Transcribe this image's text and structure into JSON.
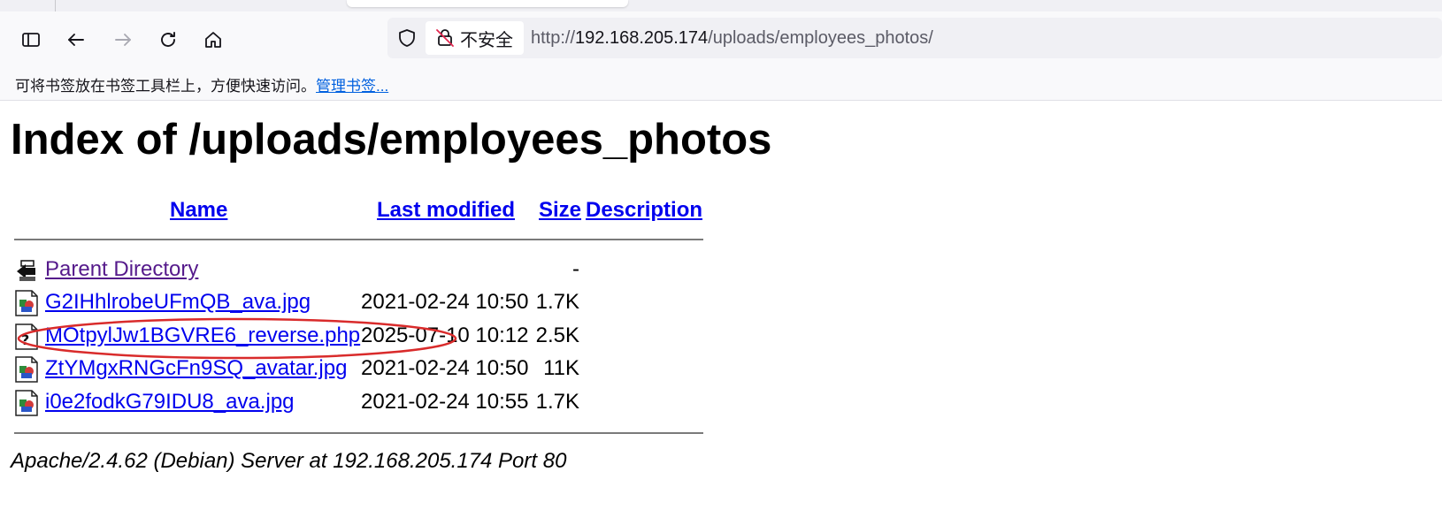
{
  "browser": {
    "insecure_label": "不安全",
    "url_scheme": "http://",
    "url_host": "192.168.205.174",
    "url_path": "/uploads/employees_photos/",
    "bookmarks_hint": "可将书签放在书签工具栏上，方便快速访问。",
    "bookmarks_manage_link": "管理书签...",
    "icons": [
      "sidebar-icon",
      "back-arrow-icon",
      "forward-arrow-icon",
      "reload-icon",
      "home-icon",
      "shield-icon",
      "insecure-lock-icon"
    ]
  },
  "page": {
    "title": "Index of /uploads/employees_photos",
    "columns": {
      "name": "Name",
      "last_modified": "Last modified",
      "size": "Size",
      "description": "Description"
    },
    "rows": [
      {
        "icon": "back-folder-icon",
        "name": "Parent Directory",
        "modified": "",
        "size": "-"
      },
      {
        "icon": "image-file-icon",
        "name": "G2IHhlrobeUFmQB_ava.jpg",
        "modified": "2021-02-24 10:50",
        "size": "1.7K"
      },
      {
        "icon": "unknown-file-icon",
        "name": "MOtpylJw1BGVRE6_reverse.php",
        "modified": "2025-07-10 10:12",
        "size": "2.5K"
      },
      {
        "icon": "image-file-icon",
        "name": "ZtYMgxRNGcFn9SQ_avatar.jpg",
        "modified": "2021-02-24 10:50",
        "size": "11K"
      },
      {
        "icon": "image-file-icon",
        "name": "i0e2fodkG79IDU8_ava.jpg",
        "modified": "2021-02-24 10:55",
        "size": "1.7K"
      }
    ],
    "footer": "Apache/2.4.62 (Debian) Server at 192.168.205.174 Port 80"
  },
  "colors": {
    "link": "#0000ee",
    "visited_link": "#551a8b",
    "annotation_ellipse": "#d92b2b"
  }
}
